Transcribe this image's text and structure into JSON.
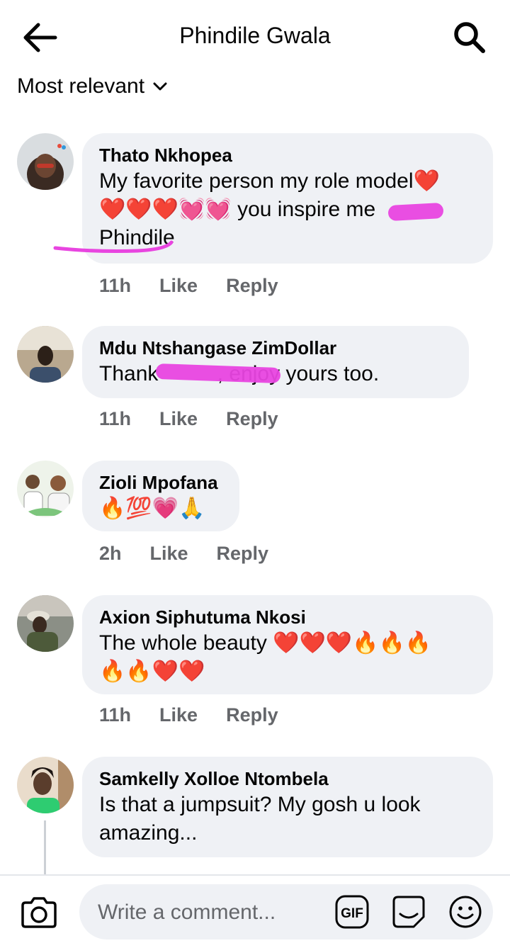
{
  "header": {
    "title": "Phindile Gwala"
  },
  "sort": {
    "label": "Most relevant"
  },
  "comments": [
    {
      "name": "Thato Nkhopea",
      "lines": [
        "My favorite person my role model❤️",
        "❤️❤️❤️💓💓 you inspire me",
        "Phindile"
      ],
      "time": "11h",
      "like": "Like",
      "reply": "Reply"
    },
    {
      "name": "Mdu Ntshangase ZimDollar",
      "lines": [
        "Thank          , enjoy yours too."
      ],
      "time": "11h",
      "like": "Like",
      "reply": "Reply"
    },
    {
      "name": "Zioli Mpofana",
      "lines": [
        "🔥💯💗🙏"
      ],
      "time": "2h",
      "like": "Like",
      "reply": "Reply"
    },
    {
      "name": "Axion Siphutuma Nkosi",
      "lines": [
        "The whole beauty ❤️❤️❤️🔥🔥🔥",
        "🔥🔥❤️❤️"
      ],
      "time": "11h",
      "like": "Like",
      "reply": "Reply"
    },
    {
      "name": "Samkelly Xolloe Ntombela",
      "lines": [
        "Is that a jumpsuit? My gosh u look",
        "amazing..."
      ]
    }
  ],
  "composer": {
    "placeholder": "Write a comment..."
  },
  "icons": {
    "back": "arrow-left-icon",
    "search": "search-icon",
    "sort": "chevron-down-icon",
    "camera": "camera-icon",
    "gif": "gif-icon",
    "sticker": "sticker-icon",
    "emoji": "smiley-icon"
  },
  "colors": {
    "bubble": "#eff1f5",
    "meta": "#65676b",
    "scribble": "#e845e0"
  }
}
